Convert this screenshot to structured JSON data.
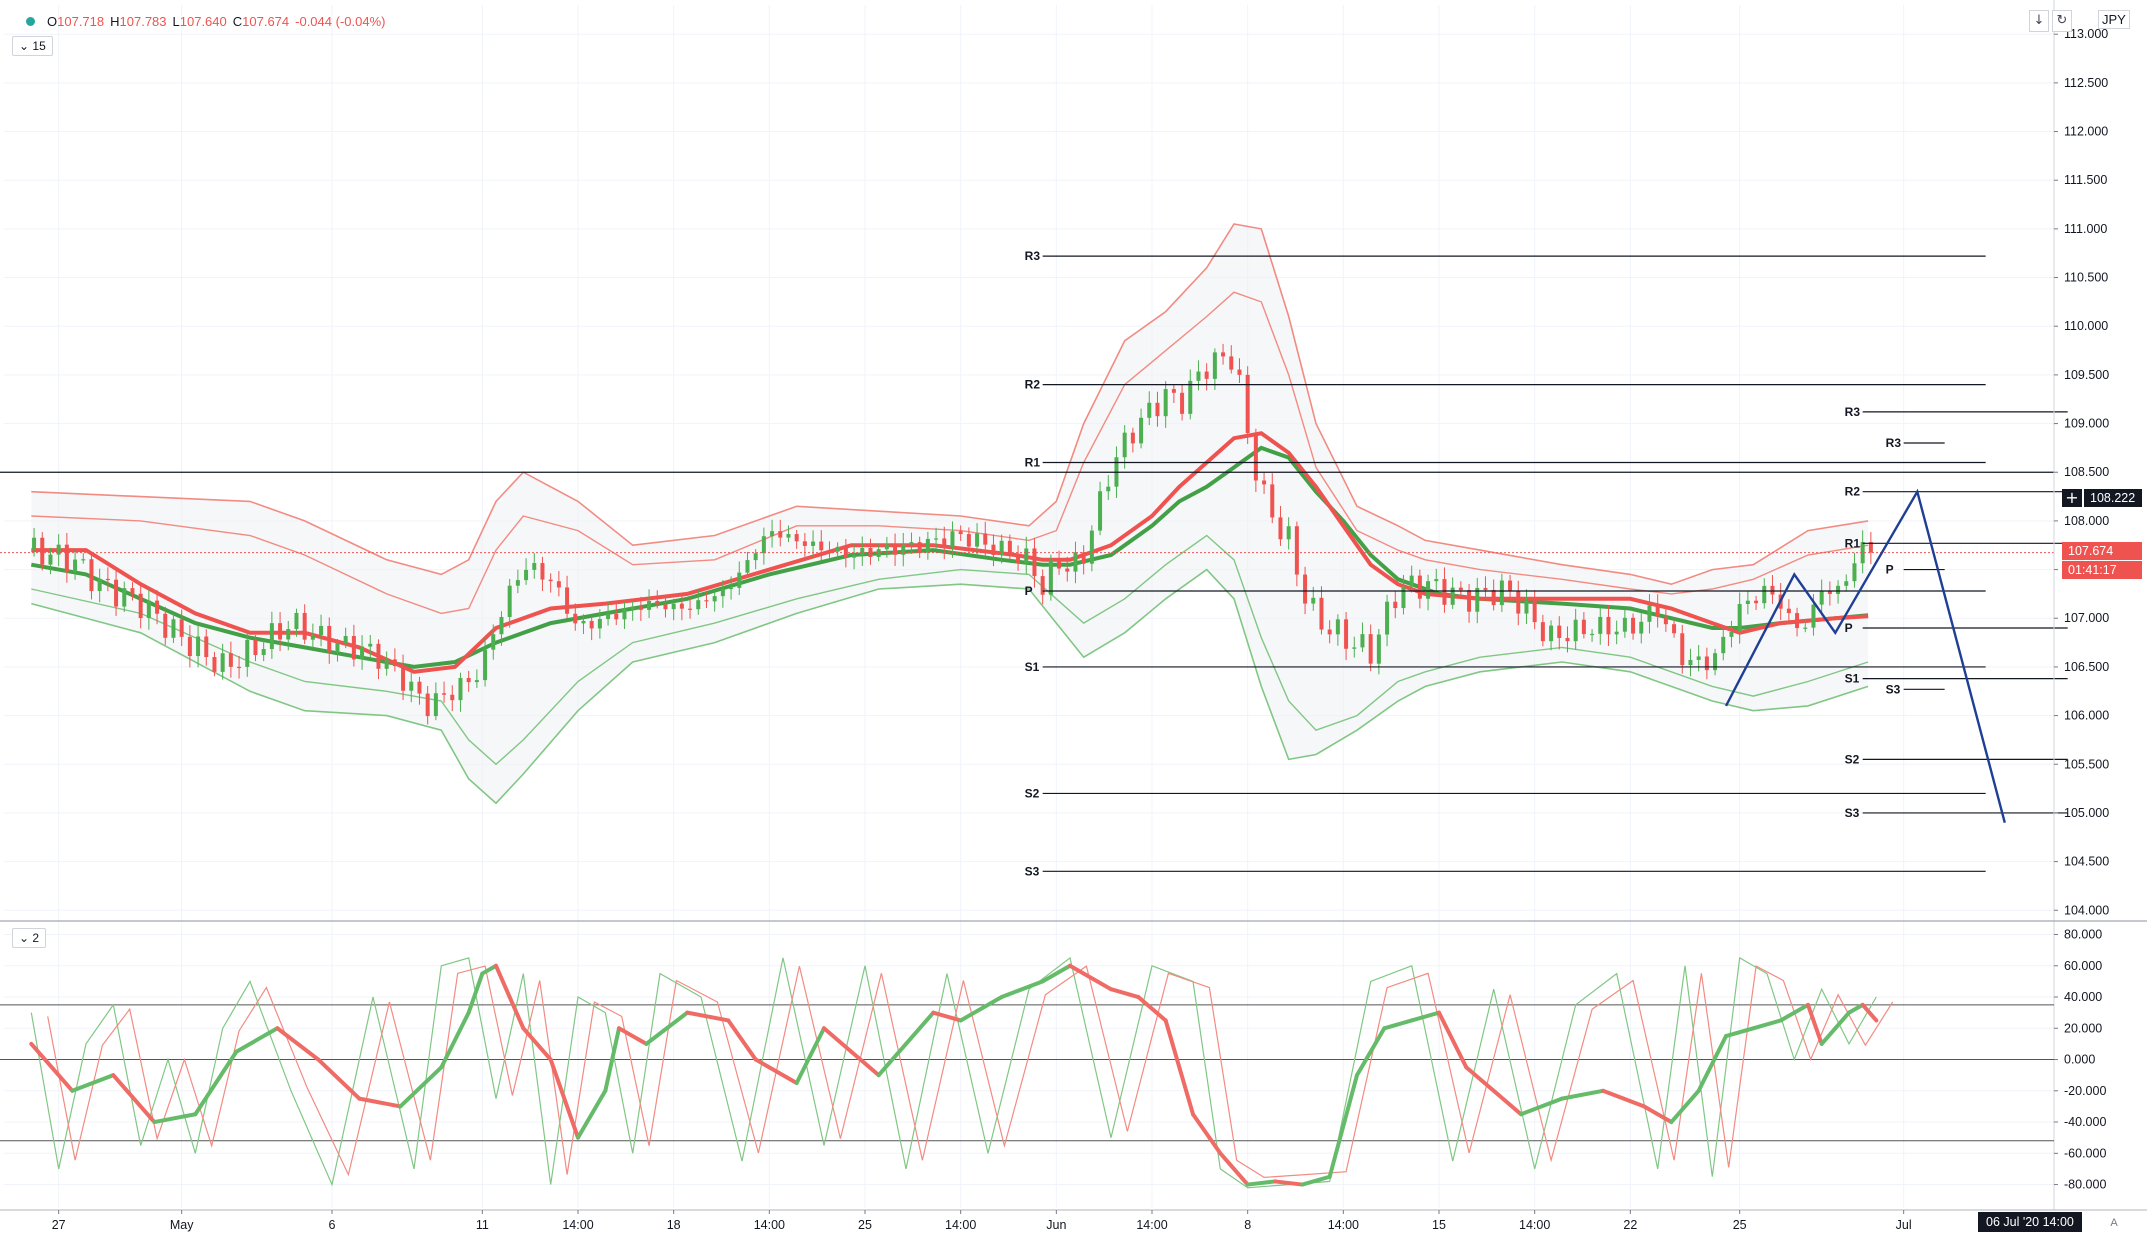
{
  "legend": {
    "open_label": "O",
    "open": "107.718",
    "high_label": "H",
    "high": "107.783",
    "low_label": "L",
    "low": "107.640",
    "close_label": "C",
    "close": "107.674",
    "change": "-0.044 (-0.04%)"
  },
  "toolbar": {
    "interval": "15",
    "oscillator_pane_index": "2",
    "scroll_down_icon": "arrow-down-icon",
    "reset_icon": "refresh-icon"
  },
  "currency": "JPY",
  "price_tags": {
    "last_price": "107.674",
    "countdown": "01:41:17",
    "crosshair_price": "108.222"
  },
  "date_tag": "06 Jul '20   14:00",
  "auto_label": "A",
  "colors": {
    "up": "#4caf50",
    "down": "#ef5350",
    "ma_red": "#ef5350",
    "ma_green": "#43a047",
    "band_red": "#f28b82",
    "band_green": "#81c784",
    "pivot": "#131722",
    "projection": "#1f3f95",
    "grid": "#f0f3fa",
    "axis_text": "#131722"
  },
  "chart_data": [
    {
      "type": "candlestick",
      "title": "",
      "pane": "price",
      "ylim": [
        103.9,
        113.3
      ],
      "y_ticks": [
        104.0,
        104.5,
        105.0,
        105.5,
        106.0,
        106.5,
        107.0,
        107.5,
        108.0,
        108.5,
        109.0,
        109.5,
        110.0,
        110.5,
        111.0,
        111.5,
        112.0,
        112.5,
        113.0
      ],
      "y_tick_labels": [
        "104.000",
        "104.500",
        "105.000",
        "105.500",
        "106.000",
        "106.500",
        "107.000",
        "107.500",
        "108.000",
        "108.500",
        "109.000",
        "109.500",
        "110.000",
        "110.500",
        "111.000",
        "111.500",
        "112.000",
        "112.500",
        "113.000"
      ],
      "x_labels": [
        "27",
        "May",
        "6",
        "11",
        "14:00",
        "18",
        "14:00",
        "25",
        "14:00",
        "Jun",
        "14:00",
        "8",
        "14:00",
        "15",
        "14:00",
        "22",
        "25",
        "Jul"
      ],
      "x_label_index": [
        10,
        55,
        110,
        165,
        200,
        235,
        270,
        305,
        340,
        375,
        410,
        445,
        480,
        515,
        550,
        585,
        625,
        685
      ],
      "x_range": [
        -10,
        740
      ],
      "close_path": {
        "x": [
          0,
          15,
          25,
          40,
          55,
          70,
          80,
          95,
          110,
          125,
          135,
          145,
          160,
          165,
          170,
          180,
          190,
          200,
          210,
          225,
          240,
          255,
          270,
          285,
          300,
          310,
          325,
          340,
          355,
          365,
          370,
          375,
          380,
          385,
          390,
          395,
          400,
          405,
          410,
          415,
          420,
          430,
          440,
          445,
          450,
          455,
          460,
          465,
          470,
          480,
          490,
          500,
          510,
          525,
          540,
          555,
          570,
          585,
          595,
          605,
          615,
          625,
          635,
          640,
          645,
          650,
          655,
          660,
          665,
          670,
          675
        ],
        "y": [
          107.7,
          107.6,
          107.35,
          107.15,
          106.8,
          106.5,
          106.65,
          106.95,
          106.75,
          106.65,
          106.4,
          106.1,
          106.35,
          106.5,
          106.95,
          107.55,
          107.4,
          106.9,
          107.0,
          107.15,
          107.1,
          107.3,
          107.9,
          107.75,
          107.65,
          107.7,
          107.75,
          107.85,
          107.7,
          107.6,
          107.3,
          107.6,
          107.5,
          107.65,
          108.1,
          108.55,
          108.8,
          109.0,
          109.15,
          109.3,
          109.2,
          109.6,
          109.7,
          108.9,
          108.3,
          108.0,
          107.8,
          107.3,
          107.0,
          106.8,
          106.65,
          107.3,
          107.35,
          107.2,
          107.3,
          106.8,
          106.9,
          106.9,
          107.1,
          106.55,
          106.55,
          107.1,
          107.3,
          107.15,
          106.9,
          106.95,
          107.3,
          107.25,
          107.45,
          107.75,
          107.68
        ]
      },
      "ma_red": {
        "x": [
          0,
          20,
          40,
          60,
          80,
          100,
          120,
          140,
          155,
          170,
          190,
          210,
          240,
          270,
          300,
          330,
          360,
          370,
          380,
          395,
          410,
          420,
          430,
          440,
          450,
          460,
          470,
          480,
          490,
          500,
          510,
          530,
          560,
          585,
          600,
          615,
          625,
          640,
          660,
          672
        ],
        "y": [
          107.7,
          107.7,
          107.35,
          107.05,
          106.85,
          106.85,
          106.7,
          106.45,
          106.5,
          106.9,
          107.1,
          107.15,
          107.25,
          107.5,
          107.75,
          107.75,
          107.65,
          107.6,
          107.6,
          107.75,
          108.05,
          108.35,
          108.6,
          108.85,
          108.9,
          108.7,
          108.35,
          107.95,
          107.55,
          107.35,
          107.25,
          107.2,
          107.2,
          107.2,
          107.1,
          106.95,
          106.85,
          106.95,
          107.0,
          107.02
        ]
      },
      "ma_green": {
        "x": [
          0,
          20,
          40,
          60,
          80,
          100,
          120,
          140,
          155,
          170,
          190,
          210,
          240,
          270,
          300,
          330,
          355,
          370,
          380,
          395,
          410,
          420,
          430,
          440,
          450,
          460,
          470,
          480,
          490,
          500,
          515,
          530,
          560,
          585,
          600,
          615,
          625,
          640,
          660,
          672
        ],
        "y": [
          107.55,
          107.45,
          107.2,
          106.95,
          106.8,
          106.7,
          106.6,
          106.5,
          106.55,
          106.75,
          106.95,
          107.05,
          107.2,
          107.45,
          107.65,
          107.7,
          107.6,
          107.55,
          107.55,
          107.65,
          107.95,
          108.2,
          108.35,
          108.55,
          108.75,
          108.65,
          108.3,
          108.0,
          107.65,
          107.4,
          107.25,
          107.2,
          107.15,
          107.1,
          107.0,
          106.9,
          106.9,
          106.95,
          107.0,
          107.03
        ]
      },
      "bands_red_outer": {
        "x": [
          0,
          40,
          80,
          100,
          130,
          150,
          160,
          170,
          180,
          200,
          220,
          250,
          280,
          310,
          340,
          365,
          375,
          385,
          400,
          415,
          430,
          440,
          450,
          460,
          470,
          485,
          500,
          510,
          530,
          560,
          585,
          600,
          615,
          630,
          650,
          672
        ],
        "y": [
          108.3,
          108.25,
          108.2,
          108.0,
          107.6,
          107.45,
          107.6,
          108.2,
          108.5,
          108.2,
          107.75,
          107.85,
          108.15,
          108.1,
          108.05,
          107.95,
          108.2,
          109.0,
          109.85,
          110.15,
          110.6,
          111.05,
          111.0,
          110.1,
          109.0,
          108.15,
          107.95,
          107.8,
          107.7,
          107.55,
          107.45,
          107.35,
          107.5,
          107.55,
          107.9,
          108.0
        ]
      },
      "bands_red_inner": {
        "x": [
          0,
          40,
          80,
          100,
          130,
          150,
          160,
          170,
          180,
          200,
          220,
          250,
          280,
          310,
          340,
          365,
          375,
          385,
          400,
          415,
          430,
          440,
          450,
          460,
          470,
          485,
          500,
          510,
          530,
          560,
          585,
          600,
          615,
          630,
          650,
          672
        ],
        "y": [
          108.05,
          108.0,
          107.85,
          107.65,
          107.25,
          107.05,
          107.1,
          107.7,
          108.05,
          107.9,
          107.55,
          107.6,
          107.95,
          107.95,
          107.9,
          107.8,
          107.9,
          108.6,
          109.4,
          109.75,
          110.1,
          110.35,
          110.25,
          109.5,
          108.55,
          107.9,
          107.7,
          107.6,
          107.5,
          107.4,
          107.3,
          107.25,
          107.3,
          107.4,
          107.65,
          107.75
        ]
      },
      "bands_green_inner": {
        "x": [
          0,
          40,
          80,
          100,
          130,
          150,
          160,
          170,
          180,
          200,
          220,
          250,
          280,
          310,
          340,
          365,
          375,
          385,
          400,
          415,
          430,
          440,
          450,
          460,
          470,
          485,
          500,
          510,
          530,
          560,
          585,
          600,
          615,
          630,
          650,
          672
        ],
        "y": [
          107.3,
          107.05,
          106.55,
          106.35,
          106.25,
          106.15,
          105.75,
          105.5,
          105.75,
          106.35,
          106.75,
          106.95,
          107.2,
          107.4,
          107.5,
          107.45,
          107.2,
          106.95,
          107.2,
          107.55,
          107.85,
          107.6,
          106.8,
          106.15,
          105.85,
          106.0,
          106.35,
          106.45,
          106.6,
          106.7,
          106.6,
          106.45,
          106.3,
          106.2,
          106.35,
          106.55
        ]
      },
      "bands_green_outer": {
        "x": [
          0,
          40,
          80,
          100,
          130,
          150,
          160,
          170,
          180,
          200,
          220,
          250,
          280,
          310,
          340,
          365,
          375,
          385,
          400,
          415,
          430,
          440,
          450,
          460,
          470,
          485,
          500,
          510,
          530,
          560,
          585,
          600,
          615,
          630,
          650,
          672
        ],
        "y": [
          107.15,
          106.85,
          106.25,
          106.05,
          106.0,
          105.85,
          105.35,
          105.1,
          105.4,
          106.05,
          106.55,
          106.75,
          107.05,
          107.3,
          107.35,
          107.3,
          106.95,
          106.6,
          106.85,
          107.2,
          107.5,
          107.2,
          106.3,
          105.55,
          105.6,
          105.85,
          106.15,
          106.3,
          106.45,
          106.55,
          106.45,
          106.3,
          106.15,
          106.05,
          106.1,
          106.3
        ]
      },
      "pivot_levels": [
        {
          "label": "R3",
          "value": 110.72,
          "x_from": 370,
          "x_to": 715
        },
        {
          "label": "R2",
          "value": 109.4,
          "x_from": 370,
          "x_to": 715
        },
        {
          "label": "R1",
          "value": 108.6,
          "x_from": 370,
          "x_to": 715
        },
        {
          "label": "P",
          "value": 107.28,
          "x_from": 370,
          "x_to": 715
        },
        {
          "label": "S1",
          "value": 106.5,
          "x_from": 370,
          "x_to": 715
        },
        {
          "label": "S2",
          "value": 105.2,
          "x_from": 370,
          "x_to": 715
        },
        {
          "label": "S3",
          "value": 104.4,
          "x_from": 370,
          "x_to": 715
        },
        {
          "label": "R3",
          "value": 109.12,
          "x_from": 670,
          "x_to": 745
        },
        {
          "label": "R2",
          "value": 108.3,
          "x_from": 670,
          "x_to": 745
        },
        {
          "label": "R1",
          "value": 107.77,
          "x_from": 670,
          "x_to": 745
        },
        {
          "label": "P",
          "value": 106.9,
          "x_from": 670,
          "x_to": 745
        },
        {
          "label": "S1",
          "value": 106.38,
          "x_from": 670,
          "x_to": 745
        },
        {
          "label": "S2",
          "value": 105.55,
          "x_from": 670,
          "x_to": 745
        },
        {
          "label": "S3",
          "value": 105.0,
          "x_from": 670,
          "x_to": 745
        },
        {
          "label": "R3",
          "value": 108.8,
          "x_from": 685,
          "x_to": 700
        },
        {
          "label": "P",
          "value": 107.5,
          "x_from": 685,
          "x_to": 700
        },
        {
          "label": "S3",
          "value": 106.27,
          "x_from": 685,
          "x_to": 700
        }
      ],
      "horizontal_line": 108.5,
      "last_price_line": 107.674,
      "projection": {
        "x": [
          620,
          645,
          660,
          690,
          722
        ],
        "y": [
          106.1,
          107.45,
          106.85,
          108.3,
          104.9
        ]
      }
    },
    {
      "type": "line",
      "title": "",
      "pane": "oscillator",
      "ylim": [
        -95,
        88
      ],
      "y_ticks": [
        -80,
        -60,
        -40,
        -20,
        0,
        20,
        40,
        60,
        80
      ],
      "y_tick_labels": [
        "-80.000",
        "-60.000",
        "-40.000",
        "-20.000",
        "0.000",
        "20.000",
        "40.000",
        "60.000",
        "80.000"
      ],
      "levels": [
        35,
        0,
        -52
      ],
      "main_line": {
        "x": [
          0,
          15,
          30,
          45,
          60,
          75,
          90,
          105,
          120,
          135,
          150,
          160,
          165,
          170,
          175,
          180,
          190,
          200,
          210,
          215,
          225,
          240,
          255,
          265,
          280,
          290,
          300,
          310,
          320,
          330,
          340,
          355,
          370,
          380,
          395,
          405,
          415,
          425,
          435,
          445,
          455,
          465,
          475,
          485,
          495,
          505,
          515,
          525,
          535,
          545,
          560,
          575,
          590,
          600,
          610,
          620,
          630,
          640,
          650,
          655,
          660,
          665,
          670,
          675
        ],
        "y": [
          10,
          -20,
          -10,
          -40,
          -35,
          5,
          20,
          0,
          -25,
          -30,
          -5,
          30,
          55,
          60,
          40,
          20,
          0,
          -50,
          -20,
          20,
          10,
          30,
          25,
          0,
          -15,
          20,
          5,
          -10,
          10,
          30,
          25,
          40,
          50,
          60,
          45,
          40,
          25,
          -35,
          -60,
          -80,
          -78,
          -80,
          -75,
          -10,
          20,
          25,
          30,
          -5,
          -20,
          -35,
          -25,
          -20,
          -30,
          -40,
          -20,
          15,
          20,
          25,
          35,
          10,
          20,
          30,
          35,
          25
        ]
      },
      "fast_line": {
        "x": [
          0,
          10,
          20,
          30,
          40,
          50,
          60,
          70,
          80,
          95,
          110,
          125,
          140,
          150,
          160,
          170,
          180,
          190,
          200,
          210,
          220,
          230,
          245,
          260,
          275,
          290,
          305,
          320,
          335,
          350,
          365,
          380,
          395,
          410,
          425,
          435,
          445,
          460,
          475,
          490,
          505,
          520,
          535,
          550,
          565,
          580,
          595,
          605,
          615,
          625,
          635,
          645,
          655,
          665,
          675
        ],
        "y": [
          30,
          -70,
          10,
          35,
          -55,
          0,
          -60,
          20,
          50,
          -20,
          -80,
          40,
          -70,
          60,
          65,
          -25,
          55,
          -80,
          40,
          30,
          -60,
          55,
          40,
          -65,
          65,
          -55,
          60,
          -70,
          55,
          -60,
          45,
          65,
          -50,
          60,
          50,
          -70,
          -82,
          -80,
          -78,
          50,
          60,
          -65,
          45,
          -70,
          35,
          55,
          -70,
          60,
          -75,
          65,
          55,
          0,
          45,
          10,
          40
        ]
      }
    }
  ]
}
